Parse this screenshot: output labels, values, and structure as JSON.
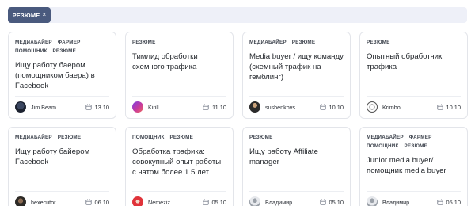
{
  "filter": {
    "label": "РЕЗЮМЕ",
    "close": "×"
  },
  "cards": [
    {
      "tags": [
        "МЕДИАБАЙЕР",
        "ФАРМЕР",
        "ПОМОЩНИК",
        "РЕЗЮМЕ"
      ],
      "title": "Ищу работу баером (помощником баера) в Facebook",
      "author": "Jim Beam",
      "date": "13.10",
      "avatar": "avatar-dark-circle"
    },
    {
      "tags": [
        "РЕЗЮМЕ"
      ],
      "title": "Тимлид обработки схемного трафика",
      "author": "Kirill",
      "date": "11.10",
      "avatar": "avatar-purple-pink"
    },
    {
      "tags": [
        "МЕДИАБАЙЕР",
        "РЕЗЮМЕ"
      ],
      "title": "Media buyer / ищу команду (схемный трафик на гемблинг)",
      "author": "sushenkovs",
      "date": "10.10",
      "avatar": "avatar-dark-figure"
    },
    {
      "tags": [
        "РЕЗЮМЕ"
      ],
      "title": "Опытный обработчик трафика",
      "author": "Krimbo",
      "date": "10.10",
      "avatar": "avatar-outline-ring"
    },
    {
      "tags": [
        "МЕДИАБАЙЕР",
        "РЕЗЮМЕ"
      ],
      "title": "Ищу работу байером Facebook",
      "author": "hexecutor",
      "date": "06.10",
      "avatar": "avatar-dark-portrait"
    },
    {
      "tags": [
        "ПОМОЩНИК",
        "РЕЗЮМЕ"
      ],
      "title": "Обработка трафика: совокупный опыт работы с чатом более 1.5 лет",
      "author": "Nemeziz",
      "date": "05.10",
      "avatar": "avatar-red-face"
    },
    {
      "tags": [
        "РЕЗЮМЕ"
      ],
      "title": "Ищу работу Affiliate manager",
      "author": "Владимир",
      "date": "05.10",
      "avatar": "avatar-grey-person"
    },
    {
      "tags": [
        "МЕДИАБАЙЕР",
        "ФАРМЕР",
        "ПОМОЩНИК",
        "РЕЗЮМЕ"
      ],
      "title": "Junior media buyer/помощник media buyer",
      "author": "Владимир",
      "date": "05.10",
      "avatar": "avatar-grey-person"
    }
  ]
}
